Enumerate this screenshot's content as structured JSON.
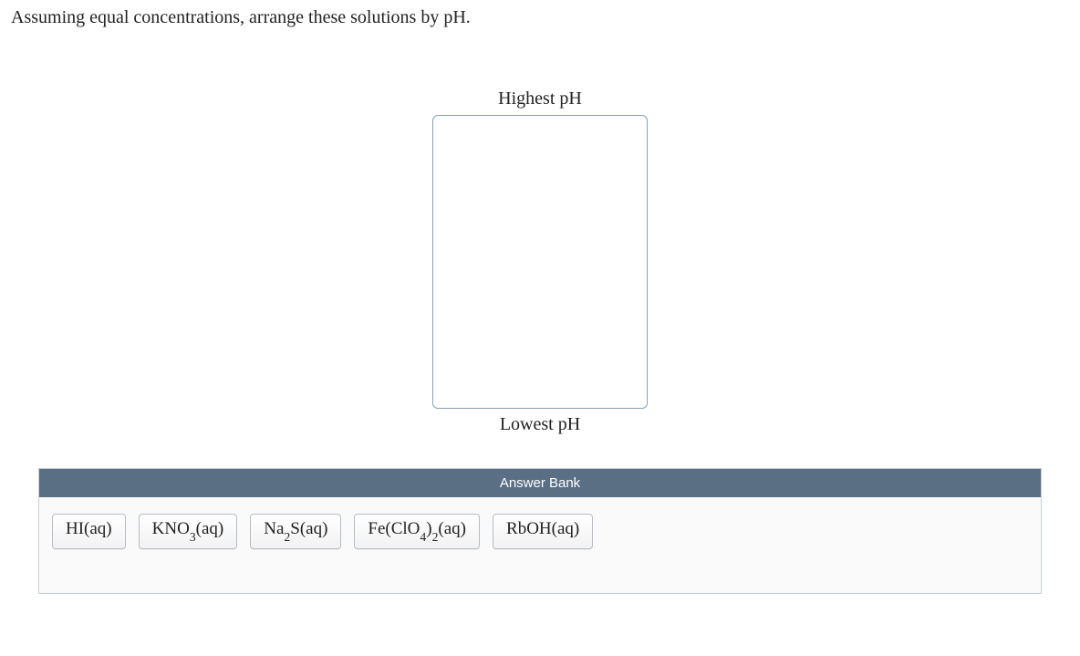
{
  "question": "Assuming equal concentrations, arrange these solutions by pH.",
  "rank": {
    "top_label": "Highest pH",
    "bottom_label": "Lowest pH"
  },
  "answer_bank": {
    "title": "Answer Bank"
  }
}
